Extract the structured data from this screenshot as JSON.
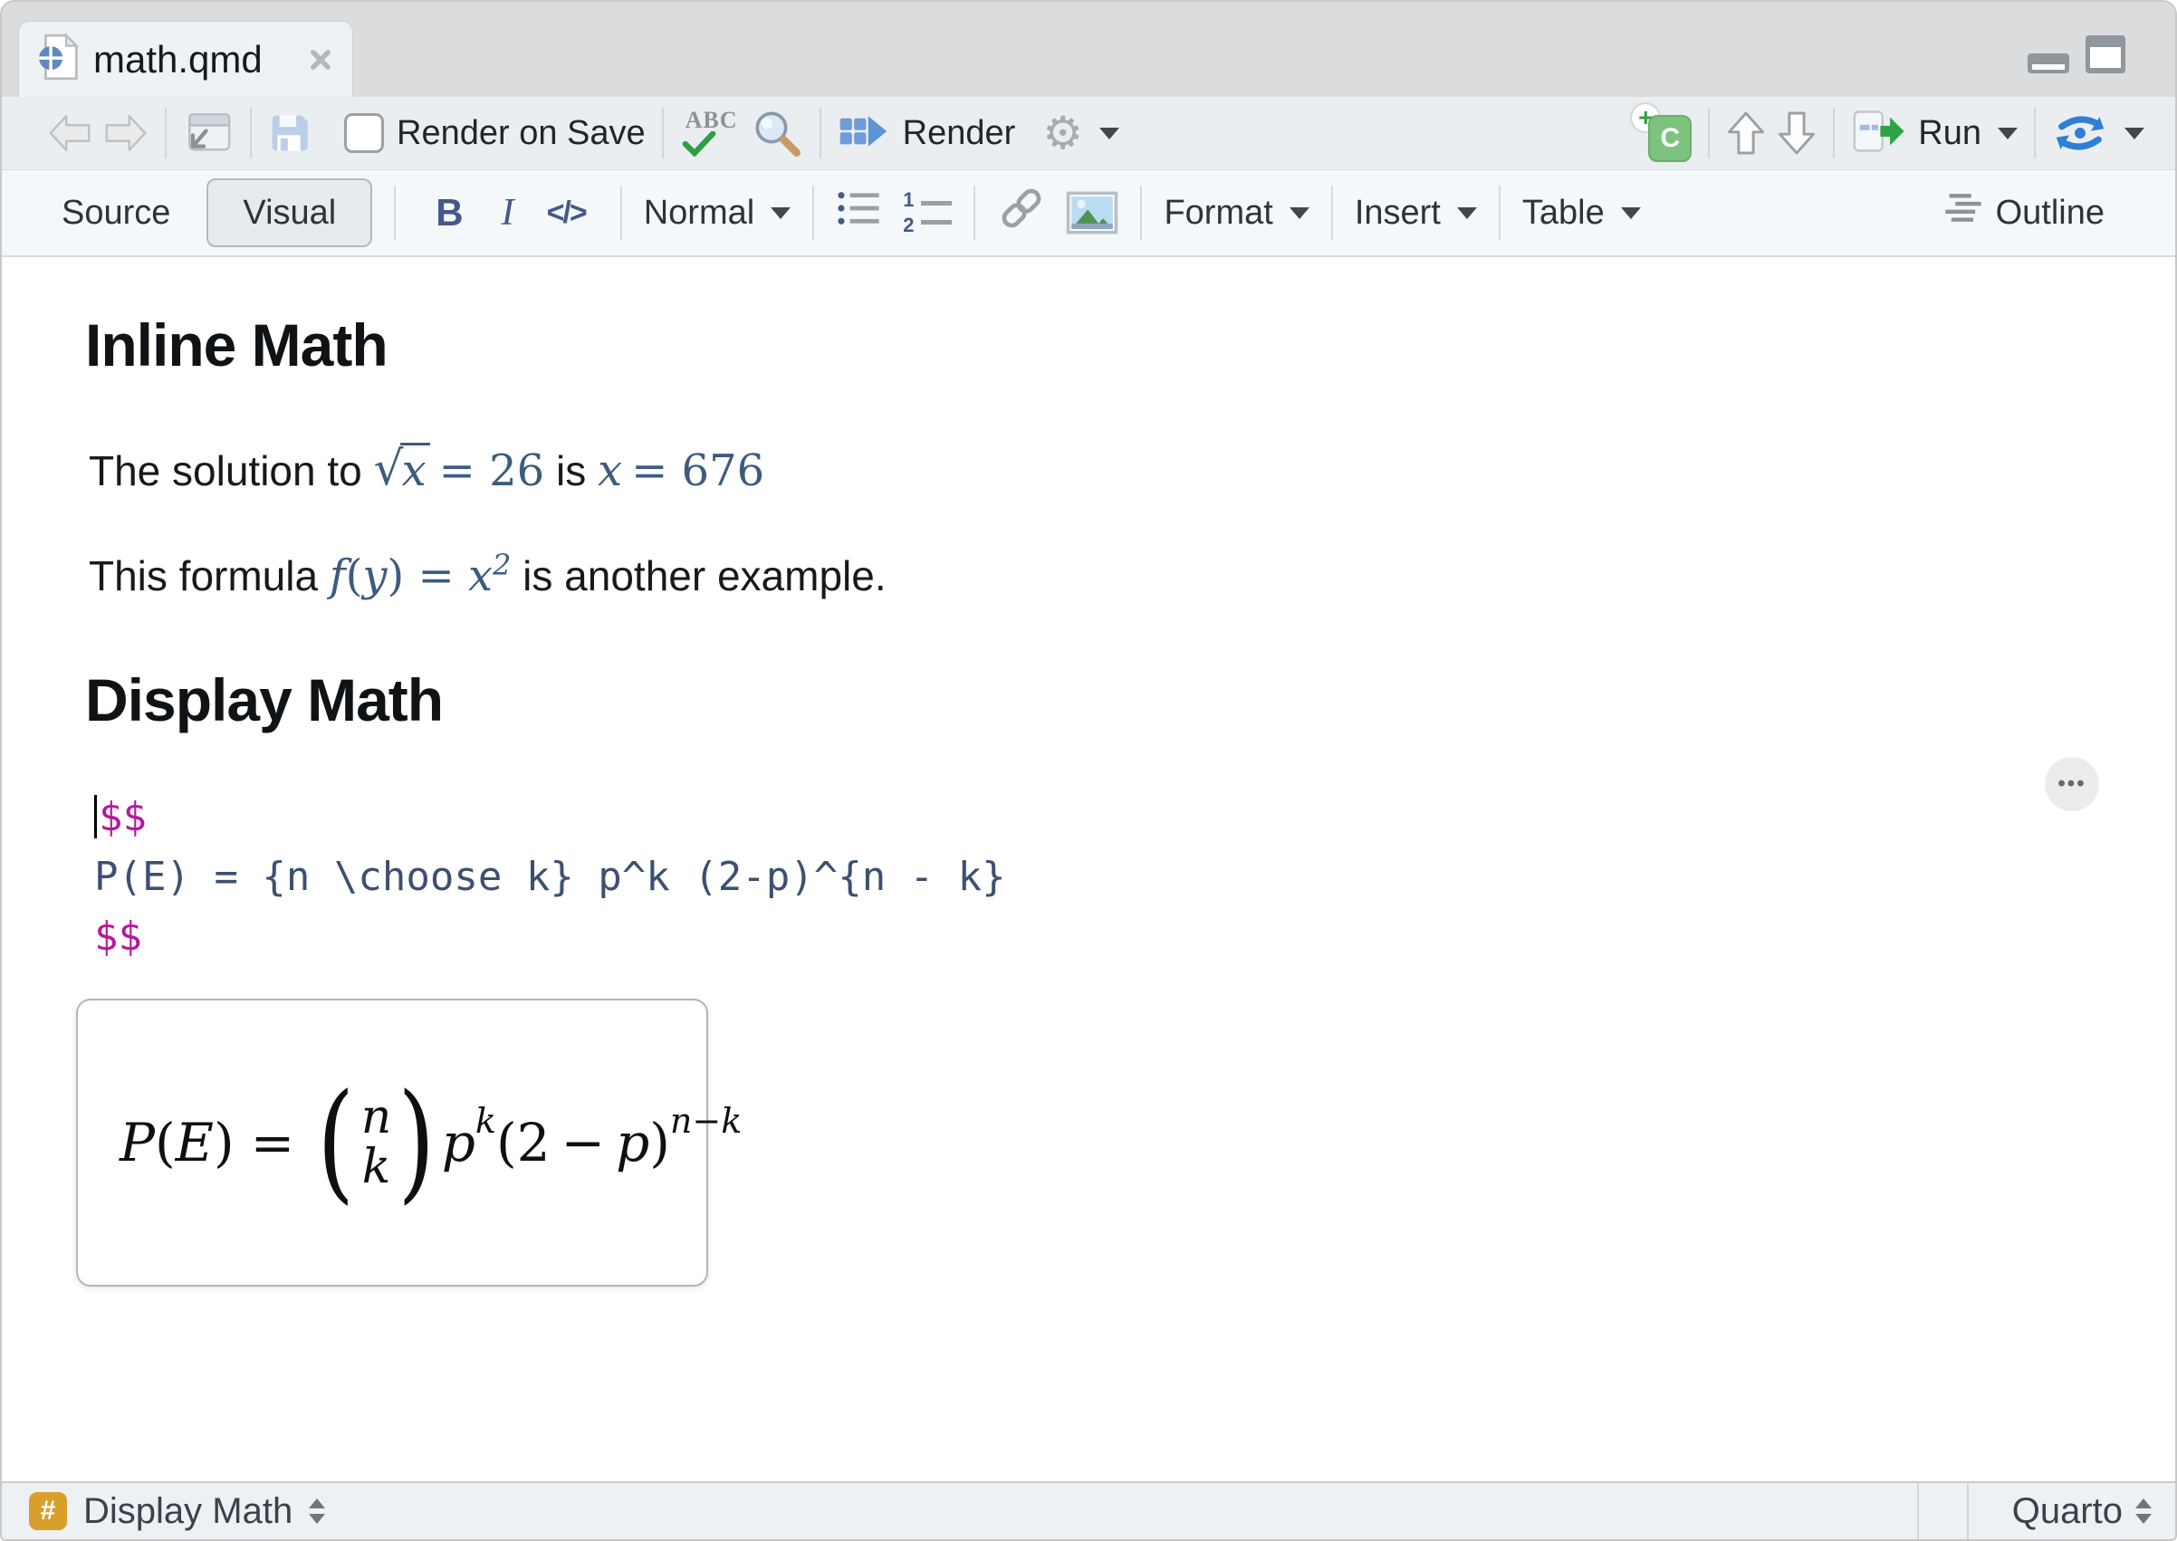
{
  "colors": {
    "math_blue": "#3e5b7e",
    "code_blue": "#3d5070",
    "dollar_magenta": "#b6199c",
    "hash_orange": "#d89f2b",
    "format_icon_blue": "#44588a",
    "render_blue": "#5e93d6",
    "run_green": "#2ea344",
    "sync_blue": "#2f7fd4",
    "chunk_green": "#7cc47e"
  },
  "tab": {
    "title": "math.qmd"
  },
  "toolbar": {
    "render_on_save_label": "Render on Save",
    "spellcheck_text": "ABC",
    "render_label": "Render",
    "run_label": "Run"
  },
  "format_bar": {
    "source_label": "Source",
    "visual_label": "Visual",
    "bold_label": "B",
    "italic_label": "I",
    "code_label": "</>",
    "style_label": "Normal",
    "ordered_num_1": "1",
    "ordered_num_2": "2",
    "format_label": "Format",
    "insert_label": "Insert",
    "table_label": "Table",
    "outline_label": "Outline"
  },
  "icons": {
    "gear_glyph": "⚙",
    "ellipsis_glyph": "•••",
    "chunk_letter": "C",
    "chunk_plus": "+"
  },
  "document": {
    "heading_inline": "Inline Math",
    "para1": {
      "text_before": "The solution to ",
      "sqrt_symbol": "√",
      "sqrt_arg": "x",
      "eq1": "= 26",
      "text_middle": " is ",
      "var2": "x",
      "eq2": "= 676"
    },
    "para2": {
      "text_before": "This formula ",
      "f": "f",
      "lparen": "(",
      "y": "y",
      "rparen": ")",
      "eq": " = ",
      "x": "x",
      "exponent": "2",
      "text_after": " is another example."
    },
    "heading_display": "Display Math",
    "code_block": {
      "line1": "$$",
      "line2": "P(E) = {n \\choose k} p^k (2-p)^{n - k}",
      "line3": "$$"
    },
    "preview": {
      "P": "P",
      "lparen": "(",
      "E": "E",
      "rparen": ")",
      "eq": "=",
      "big_lparen": "(",
      "n": "n",
      "k": "k",
      "big_rparen": ")",
      "p1": "p",
      "exp1": "k",
      "lparen2": "(",
      "two": "2",
      "minus": "−",
      "p2": "p",
      "rparen2": ")",
      "exp2": "n−k"
    }
  },
  "statusbar": {
    "hash_symbol": "#",
    "section_label": "Display Math",
    "mode_label": "Quarto"
  }
}
